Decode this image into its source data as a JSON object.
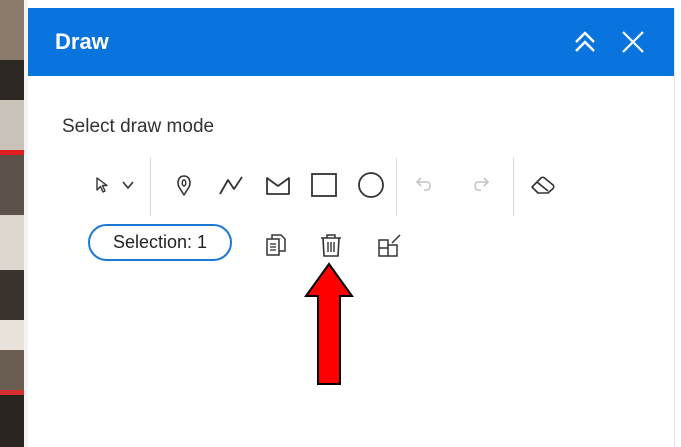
{
  "panel": {
    "title": "Draw",
    "collapse_icon": "double-chevron-up-icon",
    "close_icon": "close-icon"
  },
  "draw_mode": {
    "label": "Select draw mode",
    "tools": [
      {
        "name": "select-tool",
        "icon": "cursor-icon"
      },
      {
        "name": "select-dropdown",
        "icon": "chevron-down-icon"
      },
      {
        "name": "point-tool",
        "icon": "point-pin-icon"
      },
      {
        "name": "polyline-tool",
        "icon": "polyline-icon"
      },
      {
        "name": "polygon-tool",
        "icon": "polygon-icon"
      },
      {
        "name": "rectangle-tool",
        "icon": "rectangle-icon"
      },
      {
        "name": "circle-tool",
        "icon": "circle-icon"
      },
      {
        "name": "undo-button",
        "icon": "undo-icon",
        "enabled": false
      },
      {
        "name": "redo-button",
        "icon": "redo-icon",
        "enabled": false
      },
      {
        "name": "clear-button",
        "icon": "eraser-icon"
      }
    ]
  },
  "selection": {
    "chip_label": "Selection: 1",
    "actions": [
      {
        "name": "copy-button",
        "icon": "copy-icon"
      },
      {
        "name": "delete-button",
        "icon": "trash-icon"
      },
      {
        "name": "edit-selection-button",
        "icon": "edit-selection-icon"
      }
    ]
  },
  "colors": {
    "header": "#0a74de",
    "chip_border": "#1c78d6",
    "arrow": "#ff0000"
  }
}
